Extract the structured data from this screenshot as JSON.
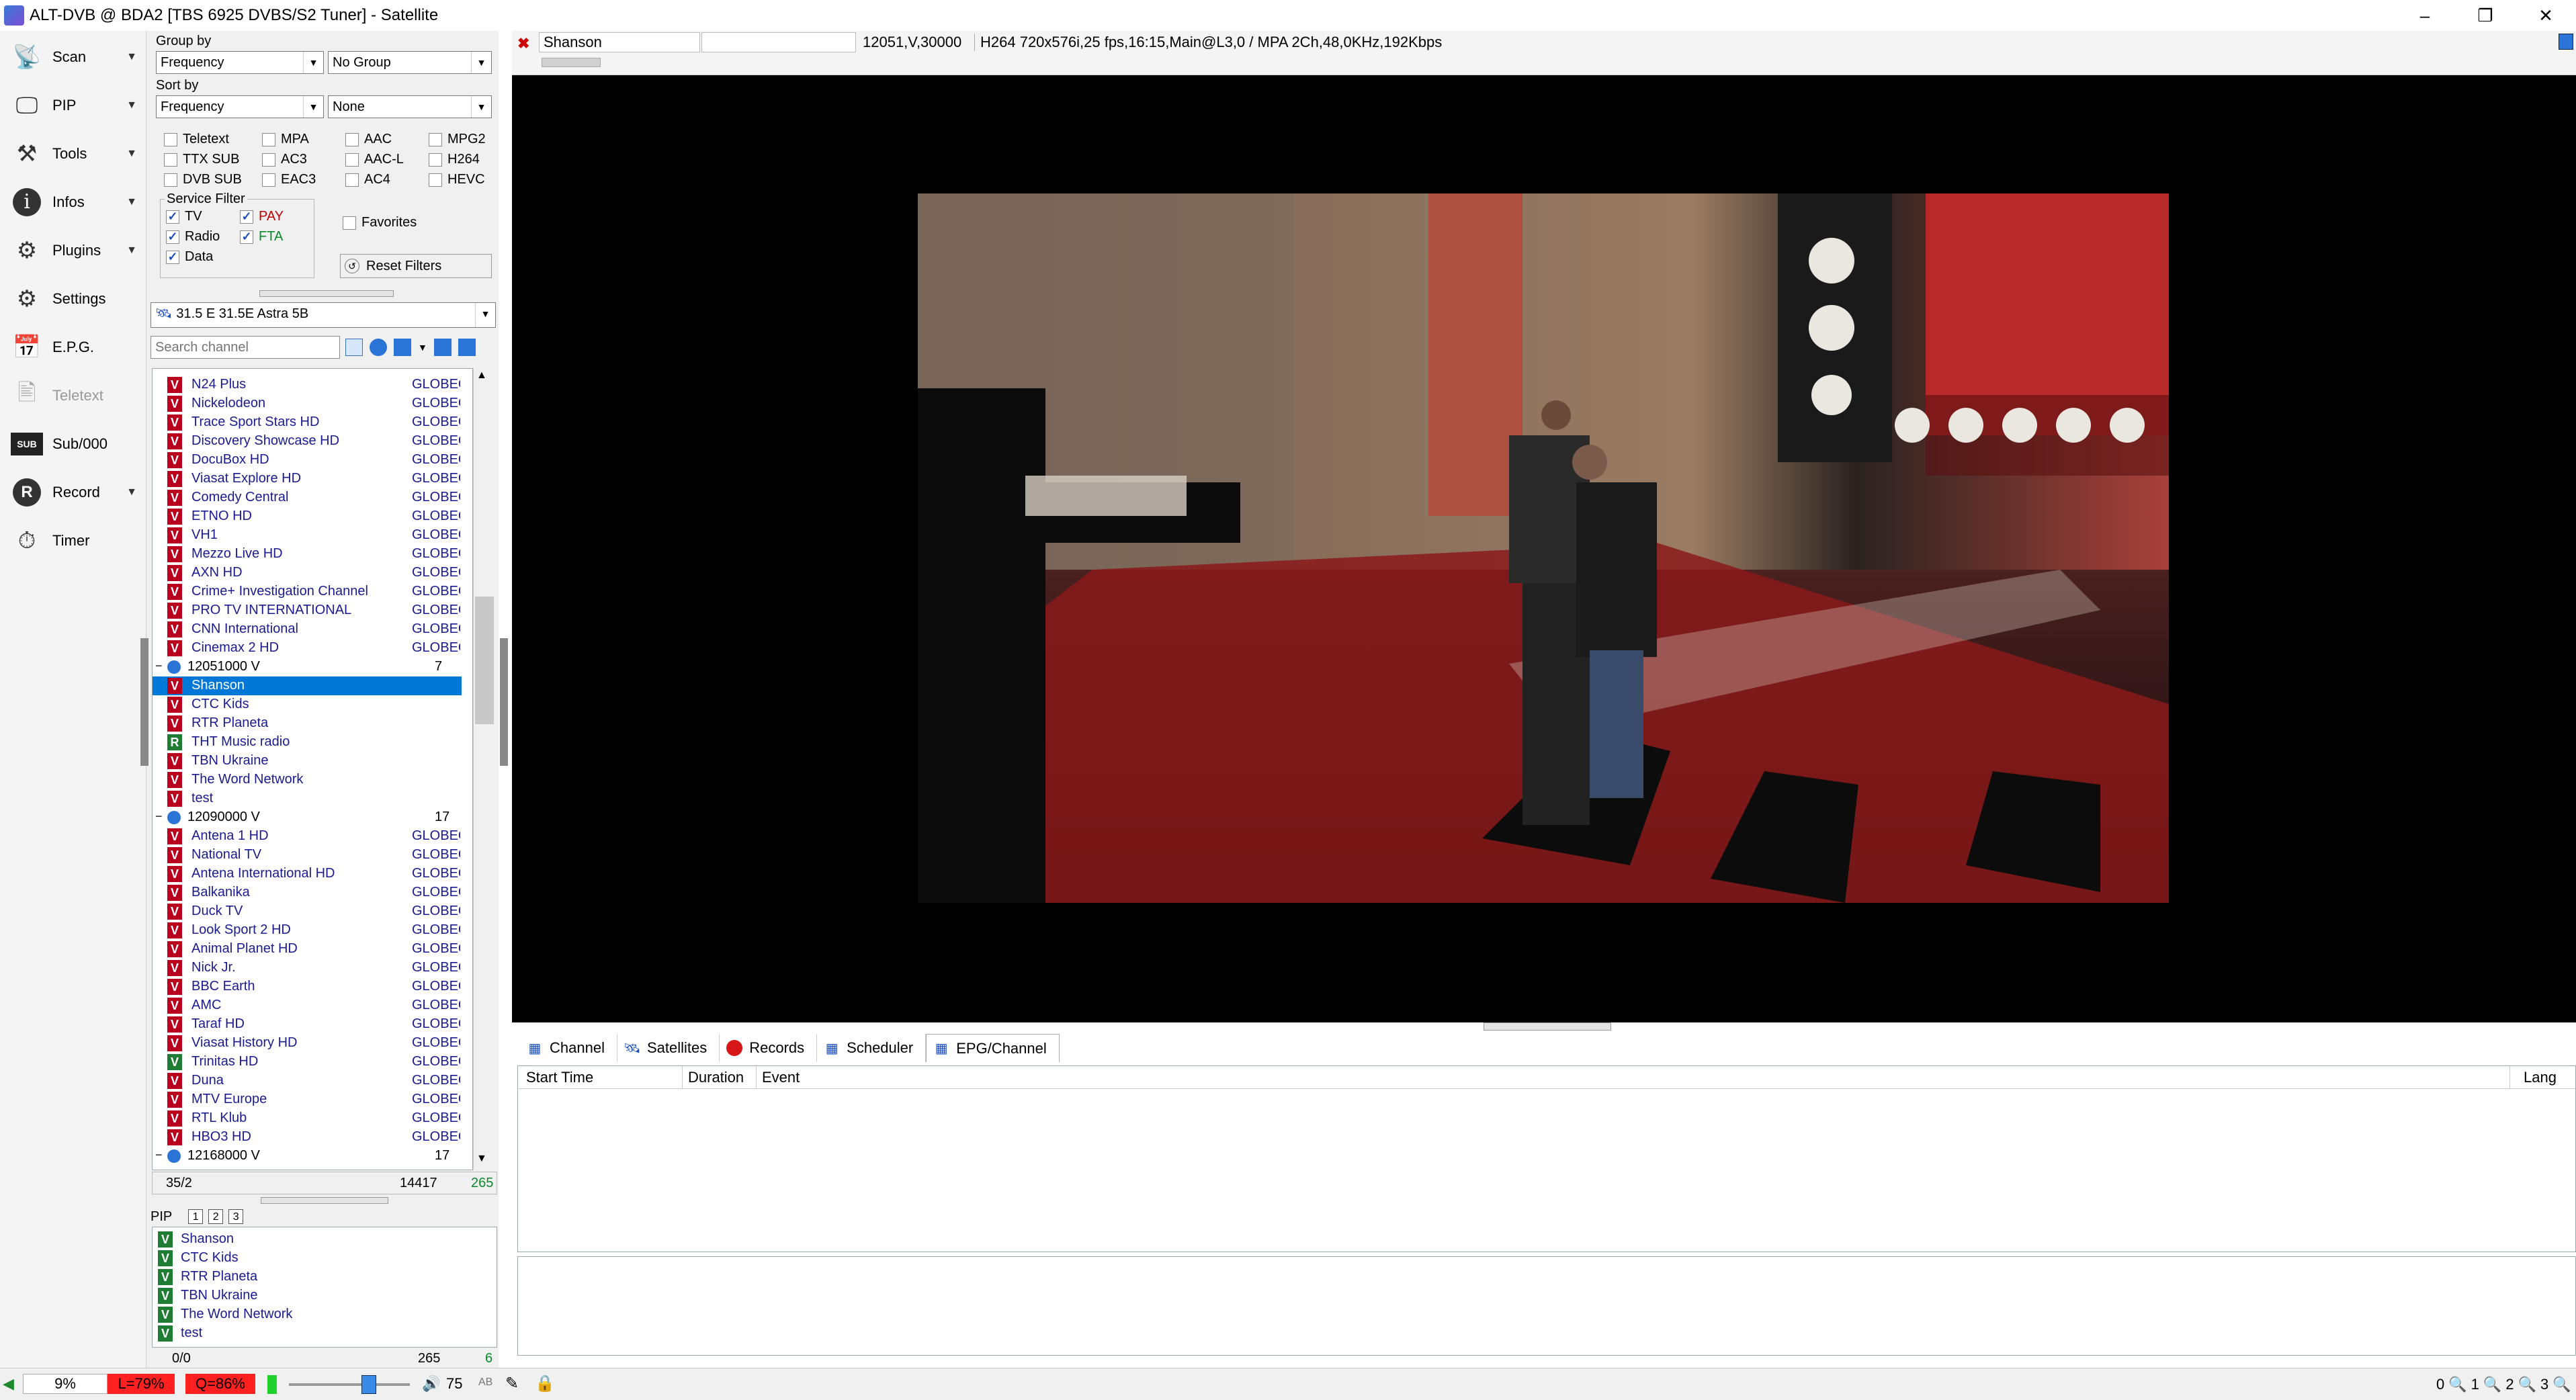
{
  "window": {
    "title": "ALT-DVB @ BDA2 [TBS 6925 DVBS/S2 Tuner] - Satellite",
    "min_label": "–",
    "max_label": "❐",
    "close_label": "✕"
  },
  "toolbar": [
    {
      "label": "Scan",
      "icon": "scan-icon",
      "arrow": true
    },
    {
      "label": "PIP",
      "icon": "pip-icon",
      "arrow": true
    },
    {
      "label": "Tools",
      "icon": "tools-icon",
      "arrow": true
    },
    {
      "label": "Infos",
      "icon": "info-icon",
      "arrow": true
    },
    {
      "label": "Plugins",
      "icon": "plugins-icon",
      "arrow": true
    },
    {
      "label": "Settings",
      "icon": "settings-icon",
      "arrow": false
    },
    {
      "label": "E.P.G.",
      "icon": "epg-icon",
      "arrow": false
    },
    {
      "label": "Teletext",
      "icon": "teletext-icon",
      "arrow": false,
      "disabled": true
    },
    {
      "label": "Sub/000",
      "icon": "subtitle-icon",
      "arrow": false
    },
    {
      "label": "Record",
      "icon": "record-icon",
      "arrow": true
    },
    {
      "label": "Timer",
      "icon": "timer-icon",
      "arrow": false
    }
  ],
  "filters": {
    "group_by_label": "Group by",
    "group_by_value": "Frequency",
    "group_secondary": "No Group",
    "sort_by_label": "Sort by",
    "sort_by_value": "Frequency",
    "sort_secondary": "None",
    "codecs": [
      [
        "Teletext",
        "MPA",
        "AAC",
        "MPG2"
      ],
      [
        "TTX SUB",
        "AC3",
        "AAC-L",
        "H264"
      ],
      [
        "DVB SUB",
        "EAC3",
        "AC4",
        "HEVC"
      ]
    ],
    "service_filter_label": "Service Filter",
    "service_tv": "TV",
    "service_pay": "PAY",
    "service_radio": "Radio",
    "service_fta": "FTA",
    "service_data": "Data",
    "favorites": "Favorites",
    "reset": "Reset Filters",
    "satellite": "31.5 E 31.5E Astra 5B",
    "search_placeholder": "Search channel"
  },
  "channels": [
    {
      "t": "V",
      "name": "N24 Plus",
      "prov": "GLOBECA"
    },
    {
      "t": "V",
      "name": "Nickelodeon",
      "prov": "GLOBECA"
    },
    {
      "t": "V",
      "name": "Trace Sport Stars HD",
      "prov": "GLOBECA"
    },
    {
      "t": "V",
      "name": "Discovery Showcase HD",
      "prov": "GLOBECA"
    },
    {
      "t": "V",
      "name": "DocuBox HD",
      "prov": "GLOBECA"
    },
    {
      "t": "V",
      "name": "Viasat Explore HD",
      "prov": "GLOBECA"
    },
    {
      "t": "V",
      "name": "Comedy Central",
      "prov": "GLOBECA"
    },
    {
      "t": "V",
      "name": "ETNO HD",
      "prov": "GLOBECA"
    },
    {
      "t": "V",
      "name": "VH1",
      "prov": "GLOBECA"
    },
    {
      "t": "V",
      "name": "Mezzo Live HD",
      "prov": "GLOBECA"
    },
    {
      "t": "V",
      "name": "AXN HD",
      "prov": "GLOBECA"
    },
    {
      "t": "V",
      "name": "Crime+ Investigation Channel",
      "prov": "GLOBECA"
    },
    {
      "t": "V",
      "name": "PRO TV INTERNATIONAL",
      "prov": "GLOBECA"
    },
    {
      "t": "V",
      "name": "CNN International",
      "prov": "GLOBECA"
    },
    {
      "t": "V",
      "name": "Cinemax 2 HD",
      "prov": "GLOBECA"
    },
    {
      "tp": true,
      "name": "12051000  V",
      "prov": "7"
    },
    {
      "t": "V",
      "name": "Shanson",
      "prov": "",
      "sel": true
    },
    {
      "t": "V",
      "name": "CTC Kids",
      "prov": ""
    },
    {
      "t": "V",
      "name": "RTR Planeta",
      "prov": ""
    },
    {
      "t": "R",
      "name": "THT Music radio",
      "prov": ""
    },
    {
      "t": "V",
      "name": "TBN Ukraine",
      "prov": ""
    },
    {
      "t": "V",
      "name": "The Word Network",
      "prov": ""
    },
    {
      "t": "V",
      "name": "test",
      "prov": ""
    },
    {
      "tp": true,
      "name": "12090000  V",
      "prov": "17"
    },
    {
      "t": "V",
      "name": "Antena 1 HD",
      "prov": "GLOBECA"
    },
    {
      "t": "V",
      "name": "National TV",
      "prov": "GLOBECA"
    },
    {
      "t": "V",
      "name": "Antena International HD",
      "prov": "GLOBECA"
    },
    {
      "t": "V",
      "name": "Balkanika",
      "prov": "GLOBECA"
    },
    {
      "t": "V",
      "name": "Duck TV",
      "prov": "GLOBECA"
    },
    {
      "t": "V",
      "name": "Look Sport 2 HD",
      "prov": "GLOBECA"
    },
    {
      "t": "V",
      "name": "Animal Planet HD",
      "prov": "GLOBECA"
    },
    {
      "t": "V",
      "name": "Nick Jr.",
      "prov": "GLOBECA"
    },
    {
      "t": "V",
      "name": "BBC Earth",
      "prov": "GLOBECA"
    },
    {
      "t": "V",
      "name": "AMC",
      "prov": "GLOBECA"
    },
    {
      "t": "V",
      "name": "Taraf HD",
      "prov": "GLOBECA"
    },
    {
      "t": "V",
      "name": "Viasat History HD",
      "prov": "GLOBECA"
    },
    {
      "t": "V",
      "name": "Trinitas HD",
      "prov": "GLOBECA",
      "fta": true
    },
    {
      "t": "V",
      "name": "Duna",
      "prov": "GLOBECA"
    },
    {
      "t": "V",
      "name": "MTV Europe",
      "prov": "GLOBECA"
    },
    {
      "t": "V",
      "name": "RTL Klub",
      "prov": "GLOBECA"
    },
    {
      "t": "V",
      "name": "HBO3 HD",
      "prov": "GLOBECA"
    },
    {
      "tp": true,
      "name": "12168000  V",
      "prov": "17"
    }
  ],
  "list_status": {
    "pos": "35/2",
    "count": "14417",
    "total": "265"
  },
  "pip": {
    "label": "PIP",
    "tabs": [
      "1",
      "2",
      "3"
    ],
    "items": [
      "Shanson",
      "CTC Kids",
      "RTR Planeta",
      "TBN Ukraine",
      "The Word Network",
      "test"
    ],
    "status_pos": "0/0",
    "status_count": "265",
    "status_total": "6"
  },
  "video": {
    "channel_name": "Shanson",
    "tp_info": "12051,V,30000",
    "stream_info": "H264 720x576i,25 fps,16:15,Main@L3,0 / MPA 2Ch,48,0KHz,192Kbps"
  },
  "bottom_tabs": [
    {
      "label": "Channel",
      "icon": "channel-icon"
    },
    {
      "label": "Satellites",
      "icon": "satellite-icon"
    },
    {
      "label": "Records",
      "icon": "records-icon"
    },
    {
      "label": "Scheduler",
      "icon": "scheduler-icon"
    },
    {
      "label": "EPG/Channel",
      "icon": "epg-channel-icon"
    }
  ],
  "epg_columns": {
    "start": "Start Time",
    "duration": "Duration",
    "event": "Event",
    "lang": "Lang"
  },
  "statusbar": {
    "signal": "9%",
    "level": "L=79%",
    "quality": "Q=86%",
    "volume": "75",
    "ab": "AB",
    "zoom": [
      "0",
      "1",
      "2",
      "3"
    ]
  },
  "colors": {
    "video_red": "#c8281e",
    "list_type_v": "#b8001e",
    "list_type_r": "#1e7d32",
    "selection": "#0078d7"
  }
}
